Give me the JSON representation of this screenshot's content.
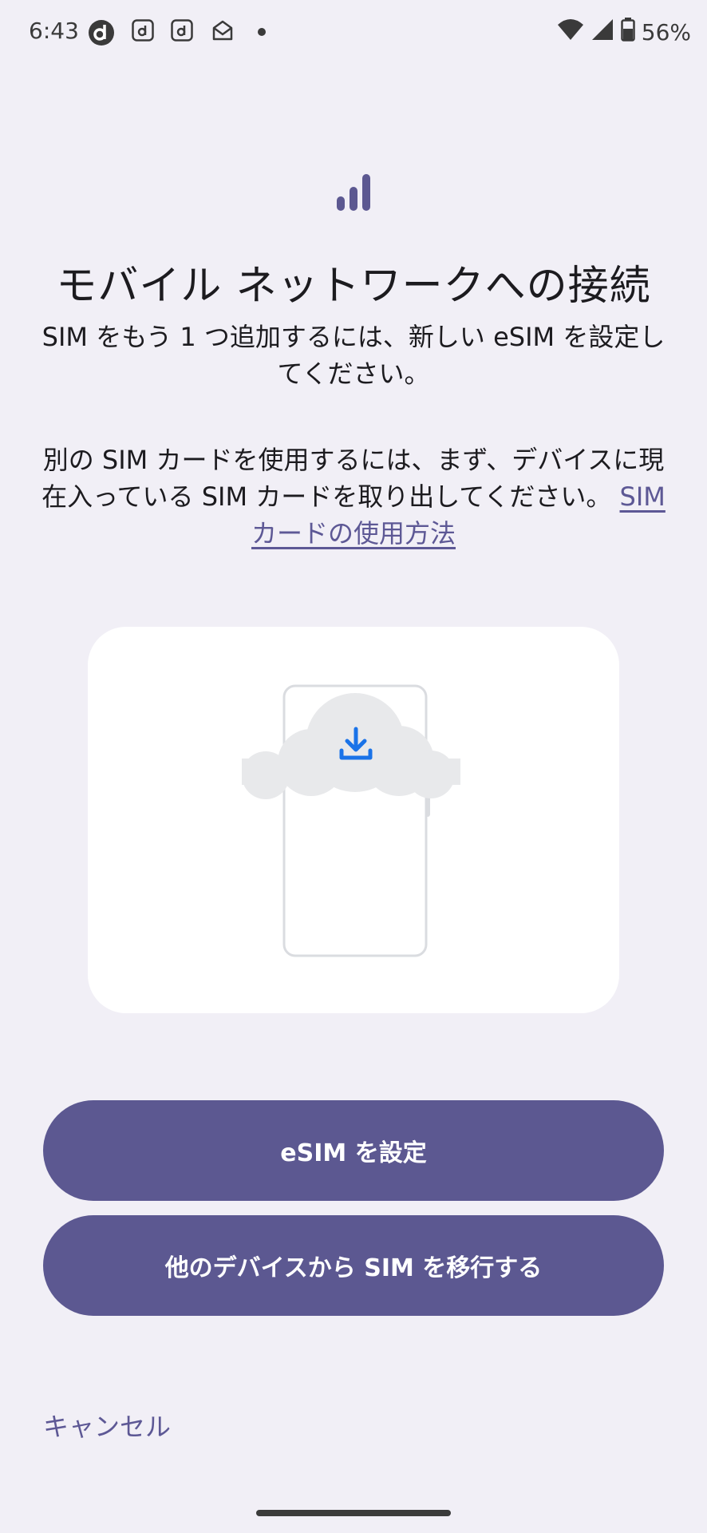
{
  "status_bar": {
    "time": "6:43",
    "battery_percent": "56%",
    "notification_icons": [
      "docomo-d-icon",
      "d-app-icon",
      "d-app-icon",
      "mail-icon",
      "more-dot-icon"
    ]
  },
  "header": {
    "title": "モバイル ネットワークへの接続",
    "subtitle": "SIM をもう 1 つ追加するには、新しい eSIM を設定してください。"
  },
  "body": {
    "text": "別の SIM カードを使用するには、まず、デバイスに現在入っている SIM カードを取り出してください。",
    "link_label": "SIM カードの使用方法"
  },
  "actions": {
    "setup_esim_label": "eSIM を設定",
    "transfer_sim_label": "他のデバイスから SIM を移行する",
    "cancel_label": "キャンセル"
  },
  "colors": {
    "background": "#f1eff6",
    "primary": "#5c5891",
    "link": "#5d5895",
    "download_icon": "#1a73e8"
  }
}
